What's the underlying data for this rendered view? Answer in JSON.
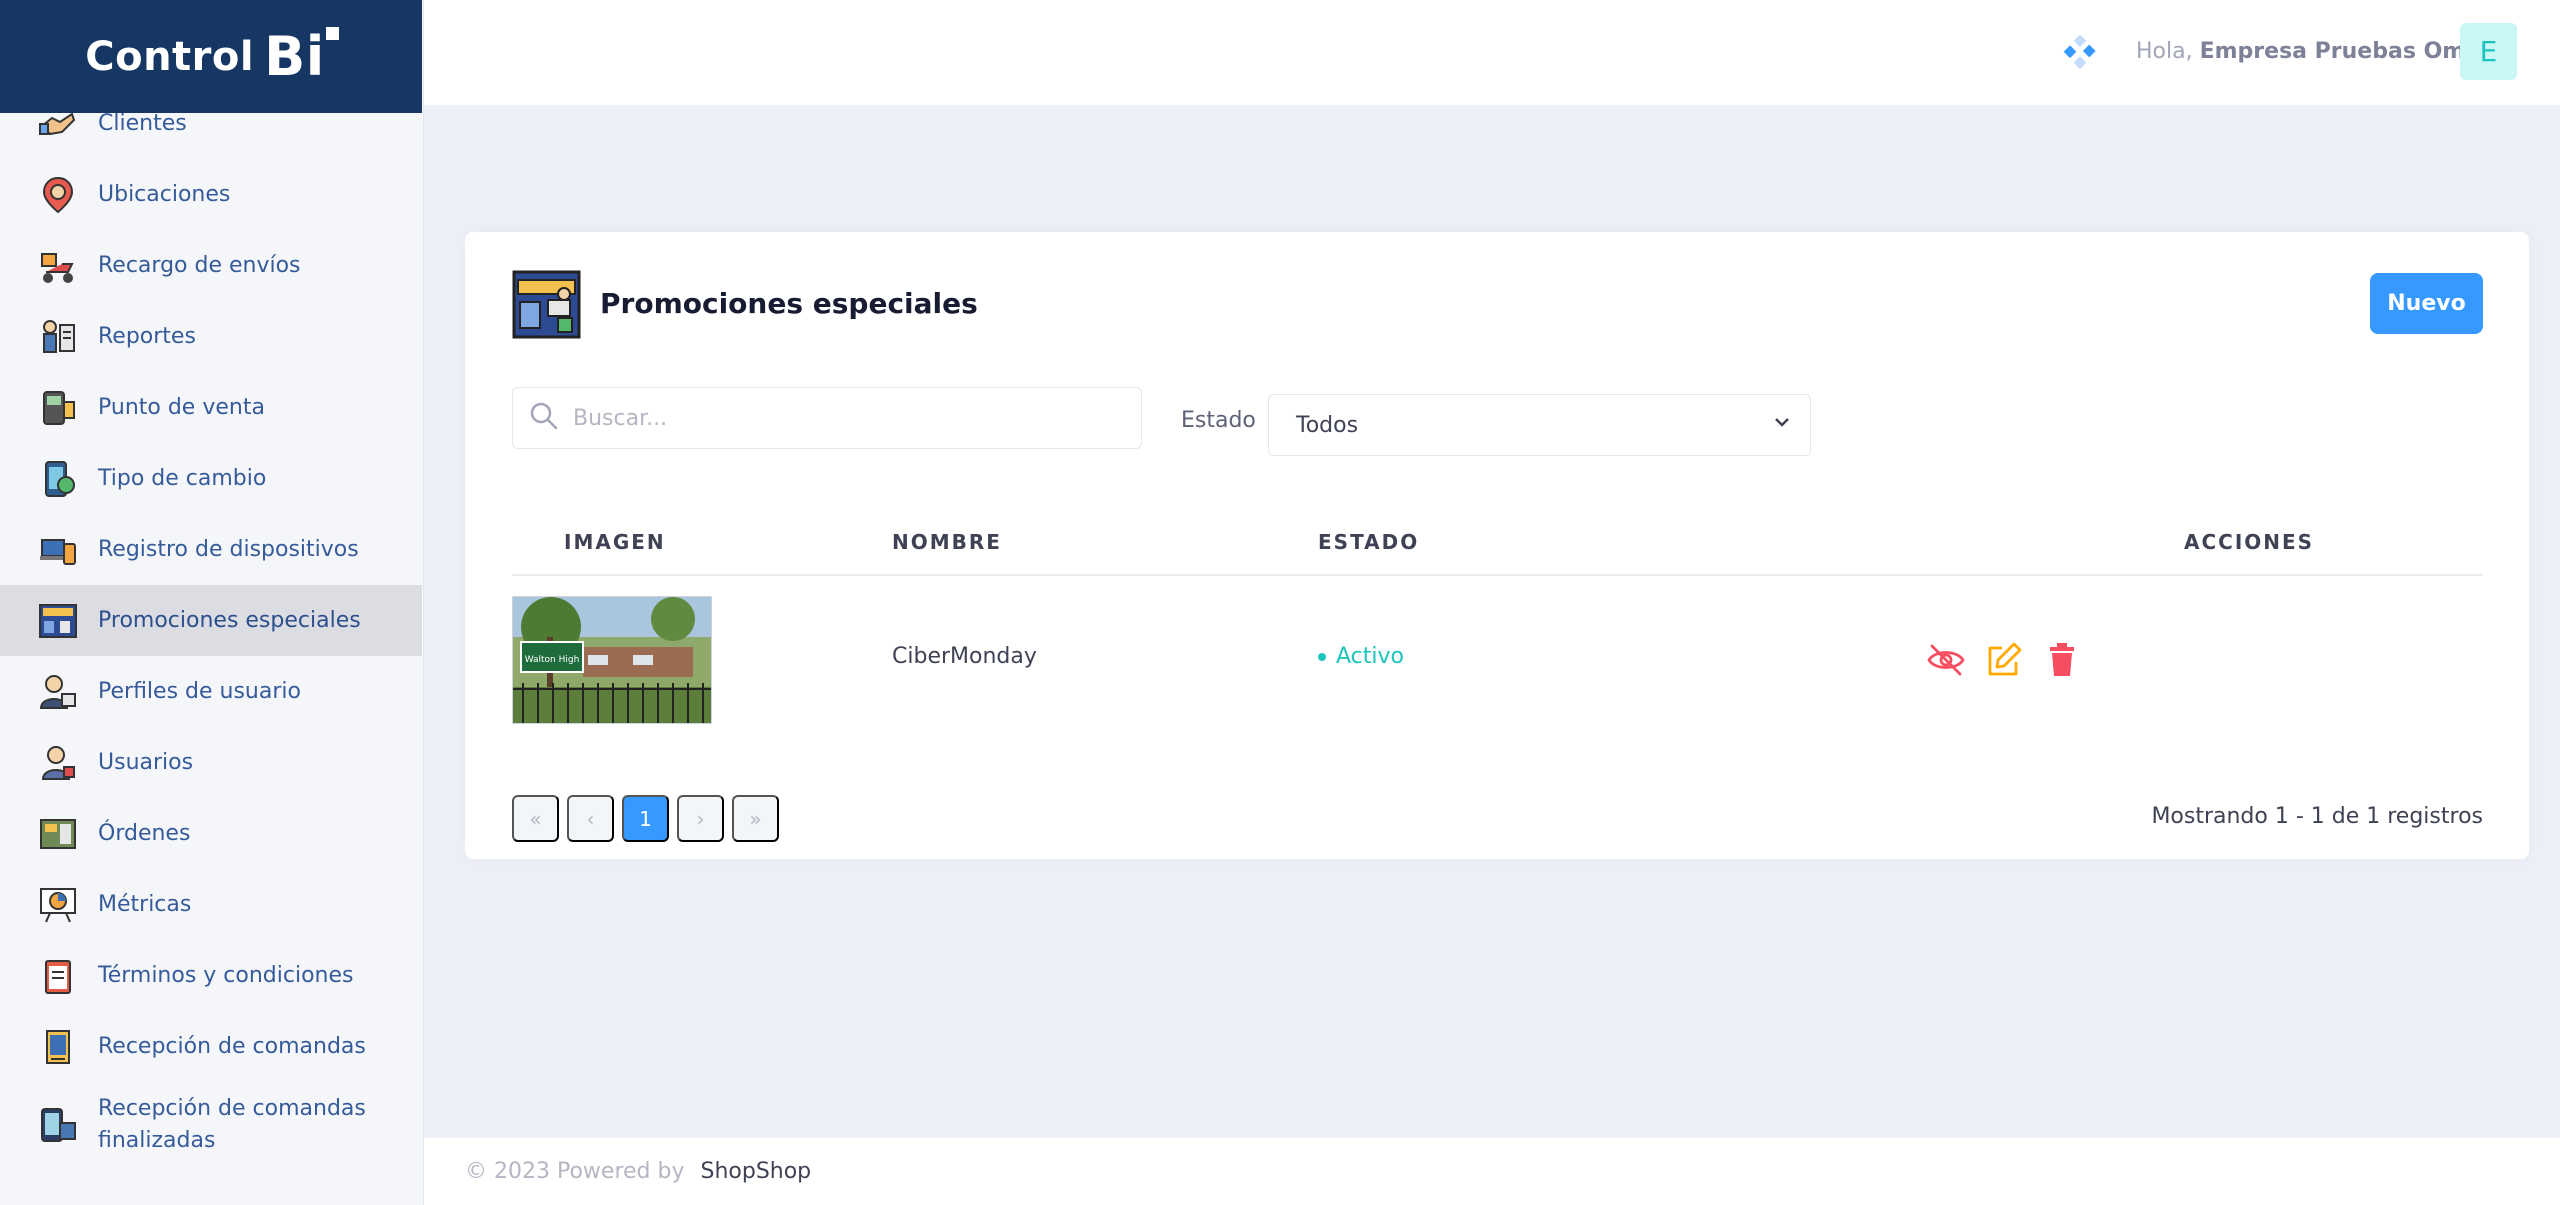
{
  "brand": {
    "word": "Control",
    "bi": "Bi"
  },
  "sidebar": {
    "items": [
      {
        "label": "Clientes",
        "icon": "handshake-icon"
      },
      {
        "label": "Ubicaciones",
        "icon": "location-pin-icon"
      },
      {
        "label": "Recargo de envíos",
        "icon": "delivery-scooter-icon"
      },
      {
        "label": "Reportes",
        "icon": "reports-icon"
      },
      {
        "label": "Punto de venta",
        "icon": "pos-terminal-icon"
      },
      {
        "label": "Tipo de cambio",
        "icon": "exchange-phone-icon"
      },
      {
        "label": "Registro de dispositivos",
        "icon": "devices-icon"
      },
      {
        "label": "Promociones especiales",
        "icon": "banner-icon",
        "active": true
      },
      {
        "label": "Perfiles de usuario",
        "icon": "user-profile-icon"
      },
      {
        "label": "Usuarios",
        "icon": "user-badge-icon"
      },
      {
        "label": "Órdenes",
        "icon": "orders-board-icon"
      },
      {
        "label": "Métricas",
        "icon": "metrics-chart-icon"
      },
      {
        "label": "Términos y condiciones",
        "icon": "clipboard-terms-icon"
      },
      {
        "label": "Recepción de comandas",
        "icon": "receipt-icon"
      },
      {
        "label": "Recepción de comandas finalizadas",
        "icon": "phone-bag-icon"
      }
    ]
  },
  "header": {
    "greeting_prefix": "Hola,",
    "user_name": "Empresa Pruebas Omar",
    "avatar_letter": "E"
  },
  "card": {
    "title": "Promociones especiales",
    "new_button": "Nuevo",
    "search": {
      "placeholder": "Buscar...",
      "value": ""
    },
    "filter": {
      "label": "Estado",
      "selected": "Todos"
    }
  },
  "table": {
    "columns": [
      "IMAGEN",
      "NOMBRE",
      "ESTADO",
      "ACCIONES"
    ],
    "rows": [
      {
        "name": "CiberMonday",
        "status": "Activo",
        "thumb_sign": "Walton High"
      }
    ]
  },
  "pagination": {
    "first": "«",
    "prev": "‹",
    "current": "1",
    "next": "›",
    "last": "»",
    "summary": "Mostrando 1 - 1 de 1 registros"
  },
  "footer": {
    "copyright": "© 2023 Powered by",
    "link": "ShopShop"
  },
  "colors": {
    "primary": "#3699ff",
    "brand": "#163763",
    "success": "#1bc5bd",
    "warning": "#ffa800",
    "danger": "#f64e60"
  }
}
